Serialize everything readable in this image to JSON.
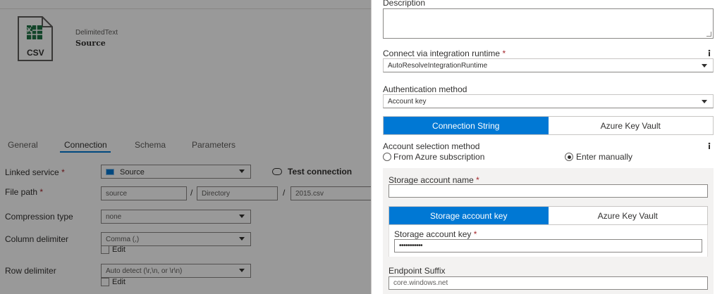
{
  "dataset": {
    "icon_text": "CSV",
    "type": "DelimitedText",
    "name": "Source"
  },
  "tabs": [
    {
      "label": "General"
    },
    {
      "label": "Connection"
    },
    {
      "label": "Schema"
    },
    {
      "label": "Parameters"
    }
  ],
  "form": {
    "linked_service_label": "Linked service",
    "linked_service_value": "Source",
    "test_connection": "Test connection",
    "file_path_label": "File path",
    "file_path_container": "source",
    "file_path_directory": "Directory",
    "file_path_file": "2015.csv",
    "slash": "/",
    "compression_label": "Compression type",
    "compression_value": "none",
    "column_delim_label": "Column delimiter",
    "column_delim_value": "Comma (,)",
    "edit_label": "Edit",
    "row_delim_label": "Row delimiter",
    "row_delim_value": "Auto detect (\\r,\\n, or \\r\\n)",
    "required_mark": "*"
  },
  "panel": {
    "description_label": "Description",
    "runtime_label": "Connect via integration runtime",
    "runtime_value": "AutoResolveIntegrationRuntime",
    "info_glyph": "i",
    "auth_label": "Authentication method",
    "auth_value": "Account key",
    "conn_tab_1": "Connection String",
    "conn_tab_2": "Azure Key Vault",
    "acct_sel_label": "Account selection method",
    "radio_1": "From Azure subscription",
    "radio_2": "Enter manually",
    "storage_name_label": "Storage account name",
    "storage_name_value": "",
    "key_tab_1": "Storage account key",
    "key_tab_2": "Azure Key Vault",
    "key_label": "Storage account key",
    "key_value": "•••••••••••",
    "endpoint_label": "Endpoint Suffix",
    "endpoint_value": "core.windows.net",
    "required_mark": "*"
  },
  "colors": {
    "accent": "#0078d4",
    "required": "#a4262c",
    "excel_green": "#217346"
  }
}
